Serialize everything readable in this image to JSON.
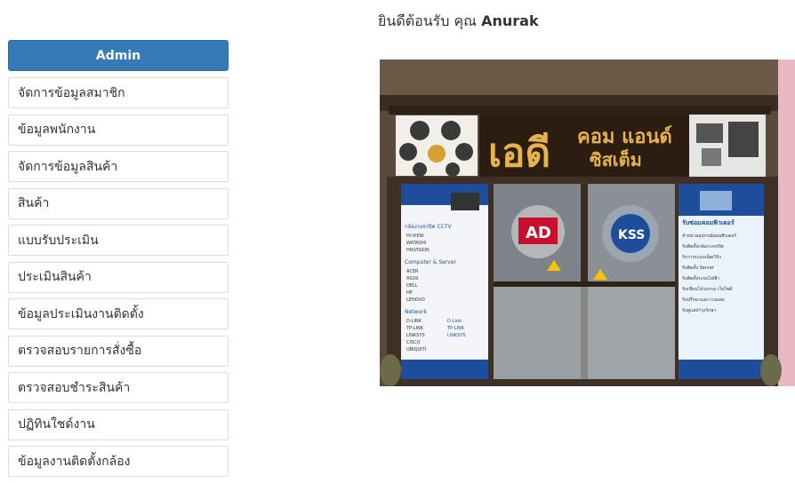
{
  "sidebar": {
    "header_label": "Admin",
    "items": [
      {
        "label": "จัดการข้อมูลสมาชิก"
      },
      {
        "label": "ข้อมูลพนักงาน"
      },
      {
        "label": "จัดการข้อมูลสินค้า"
      },
      {
        "label": "สินค้า"
      },
      {
        "label": "แบบรับประเมิน"
      },
      {
        "label": "ประเมินสินค้า"
      },
      {
        "label": "ข้อมูลประเมินงานติดตั้ง"
      },
      {
        "label": "ตรวจสอบรายการสั่งซื้อ"
      },
      {
        "label": "ตรวจสอบชำระสินค้า"
      },
      {
        "label": "ปฏิทินใชด์งาน"
      },
      {
        "label": "ข้อมูลงานติดตั้งกล้อง"
      }
    ]
  },
  "welcome": {
    "prefix": "ยินดีต้อนรับ คุณ",
    "username": "Anurak"
  },
  "storefront": {
    "sign_main": "เอดี",
    "sign_sub1": "คอม แอนด์",
    "sign_sub2": "ซิสเต็ม",
    "left_panel": {
      "sections": [
        "กล้องวงจรปิด CCTV",
        "Computer & Server",
        "Network"
      ],
      "cctv_items": [
        "HI-VIEW",
        "WATASHI",
        "HIKVISION"
      ],
      "computer_items": [
        "ACER",
        "ASUS",
        "DELL",
        "HP",
        "LENOVO"
      ],
      "network_items": [
        "D-LINK",
        "TP-LINK",
        "LINKSYS",
        "CISCO",
        "UBIQUITI"
      ],
      "brand_labels": [
        "D-Link",
        "TP-LINK",
        "LINKSYS"
      ]
    },
    "right_panel": {
      "title": "รับซ่อมคอมพิวเตอร์",
      "lines": [
        "จำหน่ายอุปกรณ์คอมพิวเตอร์",
        "รับติดตั้งกล้องวงจรปิด",
        "รับวางระบบเน็ตเวิร์ก",
        "รับติดตั้ง Server",
        "รับติดตั้งระบบไฟฟ้า",
        "รับเขียนโปรแกรม เว็บไซต์",
        "รับปรึกษาและวางแผน",
        "รับดูแลบำรุงรักษา"
      ]
    },
    "door_logo_left": "AD",
    "door_logo_right": "KSS",
    "colors": {
      "sign_bg": "#2b1d12",
      "sign_text": "#e8b24a",
      "door_frame": "#4a3a2c",
      "panel_blue": "#1e4d9c"
    }
  }
}
